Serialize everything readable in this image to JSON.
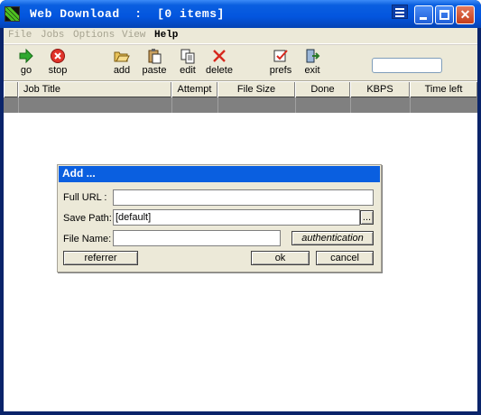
{
  "window": {
    "title": "Web Download  :  [0 items]"
  },
  "menu": {
    "items": [
      {
        "label": "File",
        "enabled": false
      },
      {
        "label": "Jobs",
        "enabled": false
      },
      {
        "label": "Options",
        "enabled": false
      },
      {
        "label": "View",
        "enabled": false
      },
      {
        "label": "Help",
        "enabled": true
      }
    ]
  },
  "toolbar": {
    "go": "go",
    "stop": "stop",
    "add": "add",
    "paste": "paste",
    "edit": "edit",
    "delete": "delete",
    "prefs": "prefs",
    "exit": "exit",
    "search_value": ""
  },
  "list": {
    "columns": [
      "Job Title",
      "Attempt",
      "File Size",
      "Done",
      "KBPS",
      "Time left"
    ]
  },
  "dialog": {
    "title": "Add ...",
    "full_url_label": "Full URL :",
    "full_url_value": "",
    "save_path_label": "Save Path:",
    "save_path_value": "[default]",
    "browse_label": "...",
    "file_name_label": "File Name:",
    "file_name_value": "",
    "authentication_label": "authentication",
    "referrer_label": "referrer",
    "ok_label": "ok",
    "cancel_label": "cancel"
  },
  "colors": {
    "titlebar": "#0355de",
    "dialog_title": "#0a5fe0",
    "face": "#ece9d8",
    "selected_row": "#808080"
  }
}
